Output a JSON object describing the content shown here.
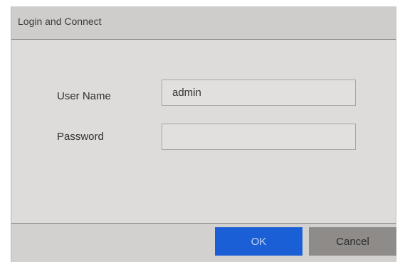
{
  "dialog": {
    "title": "Login and Connect"
  },
  "form": {
    "username_label": "User Name",
    "username_value": "admin",
    "password_label": "Password",
    "password_value": ""
  },
  "buttons": {
    "ok_label": "OK",
    "cancel_label": "Cancel"
  },
  "colors": {
    "ok_button": "#1a5fd6",
    "cancel_button": "#8e8b88",
    "dialog_background": "#dad8d6"
  }
}
